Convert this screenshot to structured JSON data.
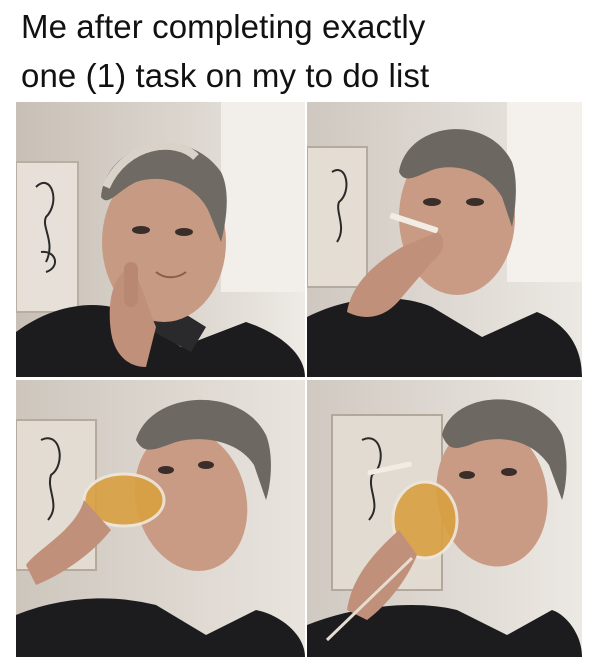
{
  "meme": {
    "caption_line_1": "Me after completing exactly",
    "caption_line_2": "one (1) task on my to do list"
  },
  "panels": [
    {
      "content": "man-thinking-hand-to-mouth"
    },
    {
      "content": "man-smoking-cigarette"
    },
    {
      "content": "man-drinking-wine"
    },
    {
      "content": "man-drinking-wine-cigarette"
    }
  ],
  "colors": {
    "wall": "#d3ccc5",
    "hoodie": "#1c1c1e",
    "skin": "#c99b84",
    "hair": "#6f6a63",
    "wine": "#d9a040"
  }
}
